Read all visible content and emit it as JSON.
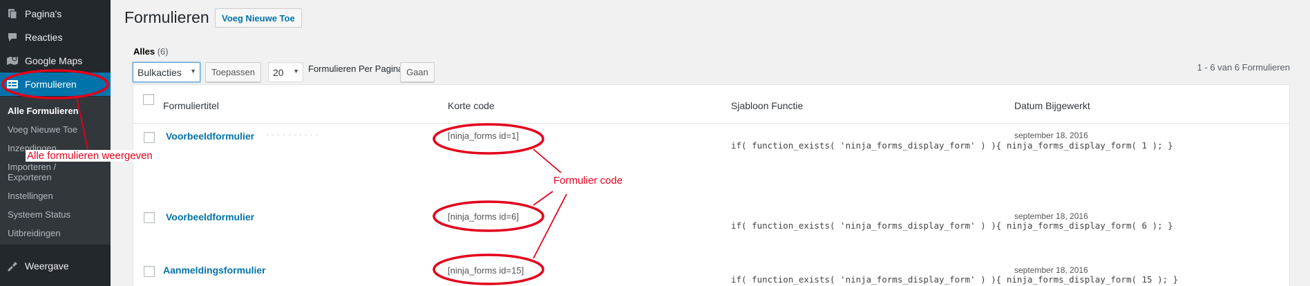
{
  "sidebar": {
    "items": [
      {
        "label": "Pagina's",
        "icon": "pages-icon"
      },
      {
        "label": "Reacties",
        "icon": "comments-icon"
      },
      {
        "label": "Google Maps",
        "icon": "map-icon"
      },
      {
        "label": "Formulieren",
        "icon": "forms-icon"
      },
      {
        "label": "Weergave",
        "icon": "appearance-icon"
      }
    ],
    "submenu": [
      "Alle Formulieren",
      "Voeg Nieuwe Toe",
      "Inzendingen",
      "Importeren /",
      "Exporteren",
      "Instellingen",
      "Systeem Status",
      "Uitbreidingen"
    ]
  },
  "page": {
    "title": "Formulieren",
    "add_new_label": "Voeg Nieuwe Toe",
    "filter_all_label": "Alles",
    "filter_all_count": "(6)"
  },
  "toolbar": {
    "bulk_actions_value": "Bulkacties",
    "apply_label": "Toepassen",
    "per_page_value": "20",
    "per_page_label": "Formulieren Per Pagina",
    "go_label": "Gaan",
    "pagination_text": "1 - 6 van 6 Formulieren"
  },
  "table": {
    "columns": [
      "Formuliertitel",
      "Korte code",
      "Sjabloon Functie",
      "Datum Bijgewerkt"
    ],
    "rows": [
      {
        "title": "Voorbeeldformulier",
        "shortcode": "[ninja_forms id=1]",
        "template": "if( function_exists( 'ninja_forms_display_form' ) ){ ninja_forms_display_form( 1 ); }",
        "date": "september 18, 2016"
      },
      {
        "title": "Voorbeeldformulier",
        "shortcode": "[ninja_forms id=6]",
        "template": "if( function_exists( 'ninja_forms_display_form' ) ){ ninja_forms_display_form( 6 ); }",
        "date": "september 18, 2016"
      },
      {
        "title": "Aanmeldingsformulier",
        "shortcode": "[ninja_forms id=15]",
        "template": "if( function_exists( 'ninja_forms_display_form' ) ){ ninja_forms_display_form( 15 ); }",
        "date": "september 18, 2016"
      }
    ]
  },
  "annotations": {
    "sidebar_note": "Alle formulieren weergeven",
    "code_note": "Formulier code",
    "color": "#e3001b"
  },
  "colors": {
    "sidebar_bg": "#23282d",
    "submenu_bg": "#32373c",
    "accent": "#0073aa"
  }
}
